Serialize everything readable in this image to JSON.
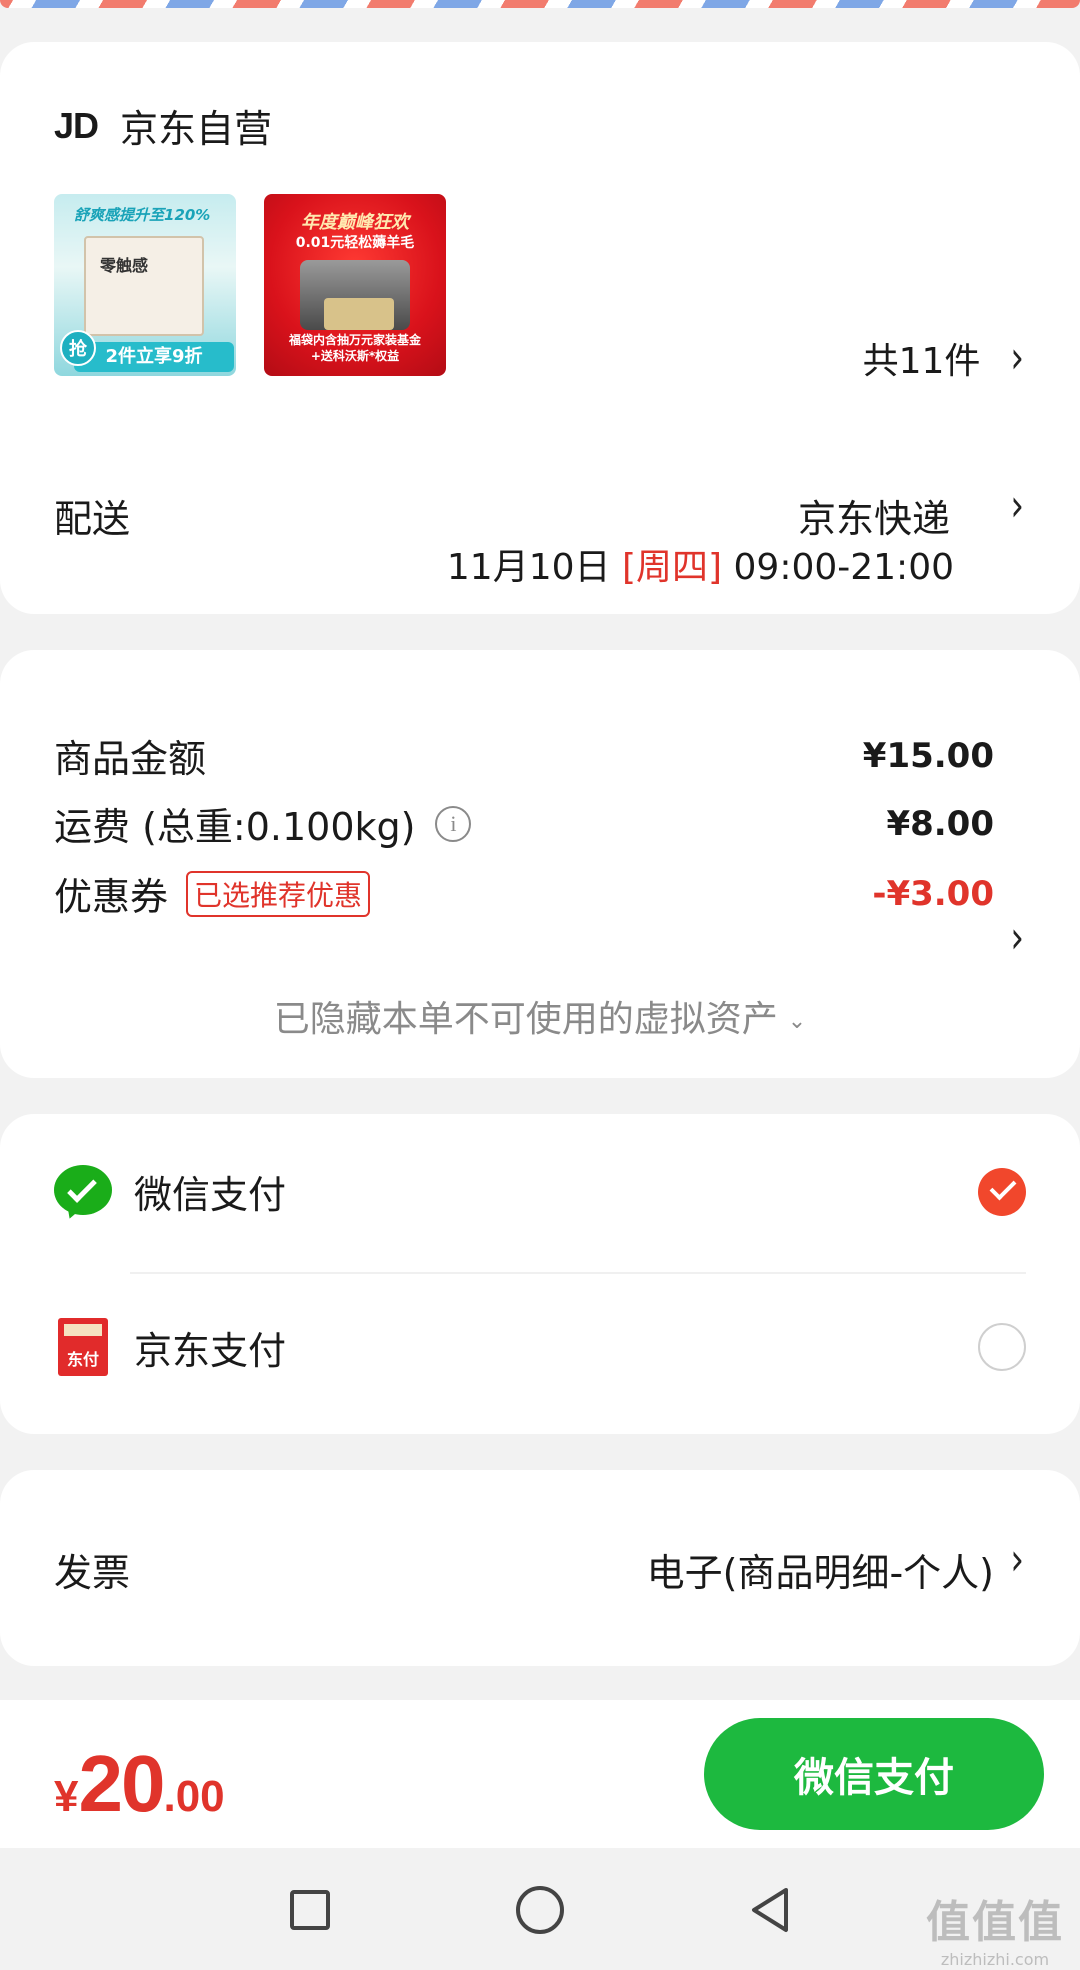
{
  "shop": {
    "logo": "JD",
    "name": "京东自营"
  },
  "products": {
    "item1": {
      "headline": "舒爽感提升至120%",
      "pack_label": "零触感",
      "grab": "抢",
      "promo": "2件立享9折"
    },
    "item2": {
      "headline": "年度巅峰狂欢",
      "sub": "0.01元轻松薅羊毛",
      "footer_line1": "福袋内含抽万元家装基金",
      "footer_line2": "+送科沃斯*权益"
    },
    "count": "共11件"
  },
  "delivery": {
    "label": "配送",
    "method": "京东快递",
    "date": "11月10日",
    "weekday": "[周四]",
    "time": "09:00-21:00"
  },
  "fees": {
    "goods_label": "商品金额",
    "goods_value": "¥15.00",
    "shipping_label": "运费 (总重:0.100kg)",
    "shipping_value": "¥8.00",
    "coupon_label": "优惠券",
    "coupon_tag": "已选推荐优惠",
    "coupon_value": "-¥3.00",
    "hidden_note": "已隐藏本单不可使用的虚拟资产",
    "info_glyph": "i"
  },
  "payment": {
    "wechat_label": "微信支付",
    "jd_label": "京东支付",
    "jd_icon_text": "东付",
    "selected": "wechat"
  },
  "invoice": {
    "label": "发票",
    "value": "电子(商品明细-个人)"
  },
  "bottom": {
    "currency": "¥",
    "total_int": "20",
    "total_dec": ".00",
    "pay_button": "微信支付"
  },
  "watermark": {
    "big": "值值值",
    "small": "zhizhizhi.com"
  },
  "colors": {
    "accent_red": "#e0342b",
    "pay_green": "#1db93f",
    "wechat_green": "#1aad19",
    "radio_orange": "#f1472c"
  },
  "icons": {
    "chevron": "chevron-right-icon",
    "info": "info-icon",
    "check": "check-icon"
  }
}
